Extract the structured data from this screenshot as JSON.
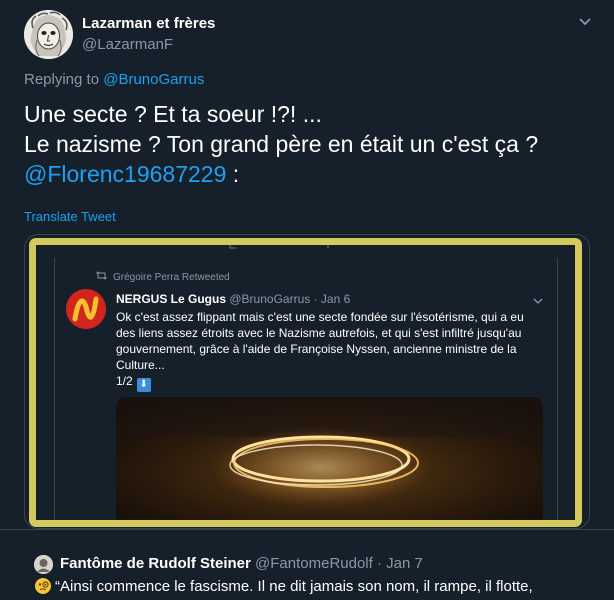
{
  "tweet": {
    "author_name": "Lazarman et frères",
    "author_handle": "@LazarmanF",
    "replying_prefix": "Replying to",
    "replying_to": "@BrunoGarrus",
    "body_line1": "Une secte ? Et ta soeur !?! ...",
    "body_line2": "Le nazisme ? Ton grand père en était un c'est ça ?",
    "body_mention": "@Florenc19687229",
    "body_suffix": " :",
    "translate_label": "Translate Tweet"
  },
  "embedded": {
    "retweet_label": "Grégoire Perra Retweeted",
    "author_name": "NERGUS Le Gugus",
    "author_handle": "@BrunoGarrus",
    "dot": " · ",
    "date": "Jan 6",
    "text": "Ok c'est assez flippant mais c'est une secte fondée sur l'ésotérisme, qui a eu des liens assez étroits avec le Nazisme autrefois, et qui s'est infiltré jusqu'au gouvernement, grâce à l'aide de Françoise Nyssen, ancienne ministre de la Culture...",
    "counter": "1/2",
    "counter_emoji": "⬇"
  },
  "quote": {
    "author_name": "Fantôme de Rudolf Steiner",
    "author_handle": "@FantomeRudolf",
    "dot": " · ",
    "date": "Jan 7",
    "text": "“Ainsi commence le fascisme. Il ne dit jamais son nom, il rampe, il flotte,"
  },
  "colors": {
    "background": "#15202b",
    "accent": "#1da1f2",
    "muted": "#8899a6",
    "highlight": "#d4c95d"
  },
  "icons": [
    "chevron-down-icon",
    "retweet-icon",
    "monocle-emoji-icon",
    "down-arrow-emoji-icon"
  ]
}
